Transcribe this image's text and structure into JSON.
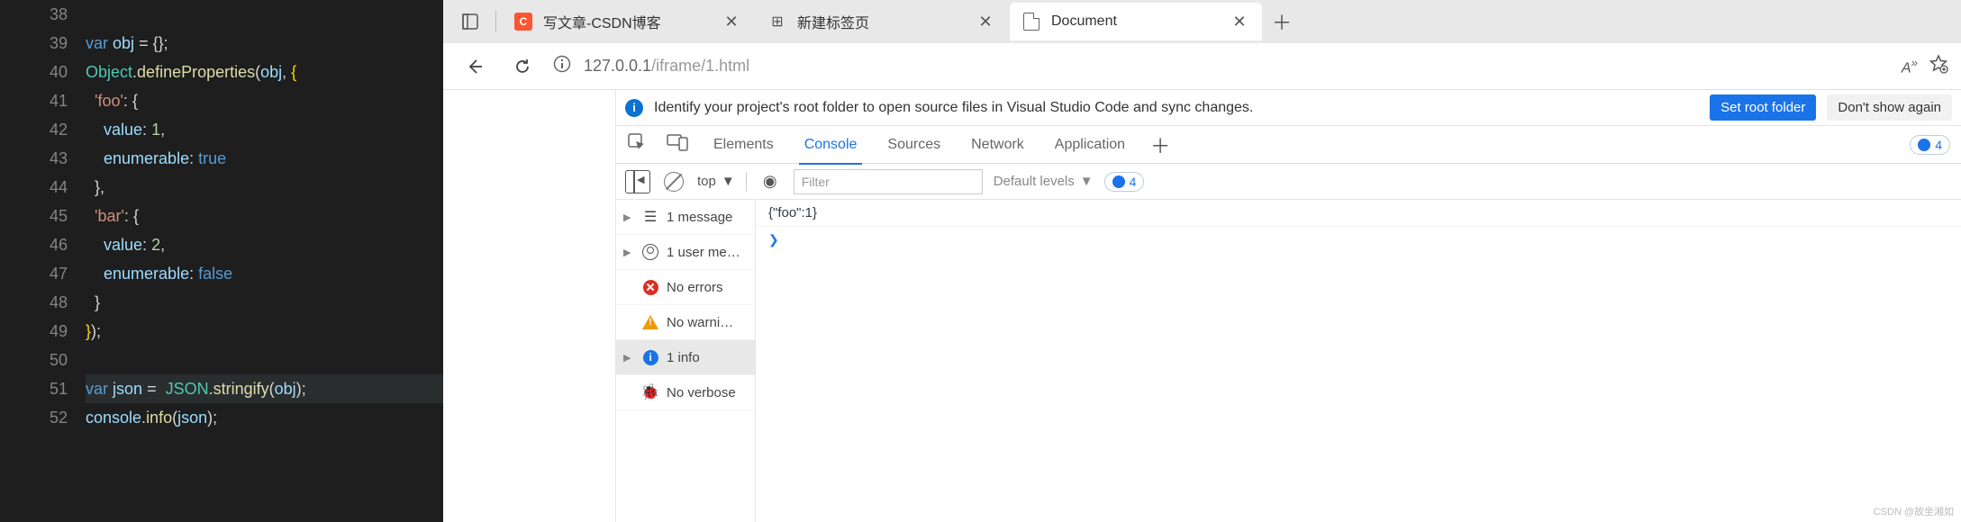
{
  "editor": {
    "lines": [
      {
        "n": "38",
        "html": ""
      },
      {
        "n": "39",
        "html": "<span class='kw'>var</span> <span class='var'>obj</span> <span class='punct'>=</span> <span class='punct'>{}</span><span class='punct'>;</span>"
      },
      {
        "n": "40",
        "html": "<span class='cls'>Object</span><span class='punct'>.</span><span class='fn'>defineProperties</span><span class='punct'>(</span><span class='var'>obj</span><span class='punct'>,</span> <span class='brace'>{</span>"
      },
      {
        "n": "41",
        "html": "  <span class='str'>'foo'</span><span class='punct'>:</span> <span class='punct'>{</span>"
      },
      {
        "n": "42",
        "html": "    <span class='var'>value</span><span class='punct'>:</span> <span class='num'>1</span><span class='punct'>,</span>"
      },
      {
        "n": "43",
        "html": "    <span class='var'>enumerable</span><span class='punct'>:</span> <span class='bool'>true</span>"
      },
      {
        "n": "44",
        "html": "  <span class='punct'>}</span><span class='punct'>,</span>"
      },
      {
        "n": "45",
        "html": "  <span class='str'>'bar'</span><span class='punct'>:</span> <span class='punct'>{</span>"
      },
      {
        "n": "46",
        "html": "    <span class='var'>value</span><span class='punct'>:</span> <span class='num'>2</span><span class='punct'>,</span>"
      },
      {
        "n": "47",
        "html": "    <span class='var'>enumerable</span><span class='punct'>:</span> <span class='bool'>false</span>"
      },
      {
        "n": "48",
        "html": "  <span class='punct'>}</span>"
      },
      {
        "n": "49",
        "html": "<span class='brace'>}</span><span class='punct'>)</span><span class='punct'>;</span>"
      },
      {
        "n": "50",
        "html": ""
      },
      {
        "n": "51",
        "html": "<span class='kw'>var</span> <span class='var'>json</span> <span class='punct'>=</span>  <span class='cls'>JSON</span><span class='punct'>.</span><span class='fn'>stringify</span><span class='punct'>(</span><span class='var'>obj</span><span class='punct'>)</span><span class='punct'>;</span>",
        "hl": true
      },
      {
        "n": "52",
        "html": "<span class='var'>console</span><span class='punct'>.</span><span class='fn'>info</span><span class='punct'>(</span><span class='var'>json</span><span class='punct'>)</span><span class='punct'>;</span>"
      }
    ]
  },
  "tabs": [
    {
      "title": "写文章-CSDN博客",
      "icon": "csdn",
      "active": false
    },
    {
      "title": "新建标签页",
      "icon": "grid",
      "active": false
    },
    {
      "title": "Document",
      "icon": "doc",
      "active": true
    }
  ],
  "address": {
    "host": "127.0.0.1",
    "path": "/iframe/1.html"
  },
  "infobar": {
    "text": "Identify your project's root folder to open source files in Visual Studio Code and sync changes.",
    "primary": "Set root folder",
    "secondary": "Don't show again"
  },
  "devtabs": {
    "items": [
      "Elements",
      "Console",
      "Sources",
      "Network",
      "Application"
    ],
    "active": "Console",
    "badge": "4"
  },
  "toolbar": {
    "context": "top",
    "filter_placeholder": "Filter",
    "levels": "Default levels",
    "count": "4"
  },
  "sidebar": {
    "messages": "1 message",
    "user": "1 user me…",
    "errors": "No errors",
    "warnings": "No warni…",
    "info": "1 info",
    "verbose": "No verbose"
  },
  "console_output": "{\"foo\":1}",
  "watermark": "CSDN @故坐湘如"
}
